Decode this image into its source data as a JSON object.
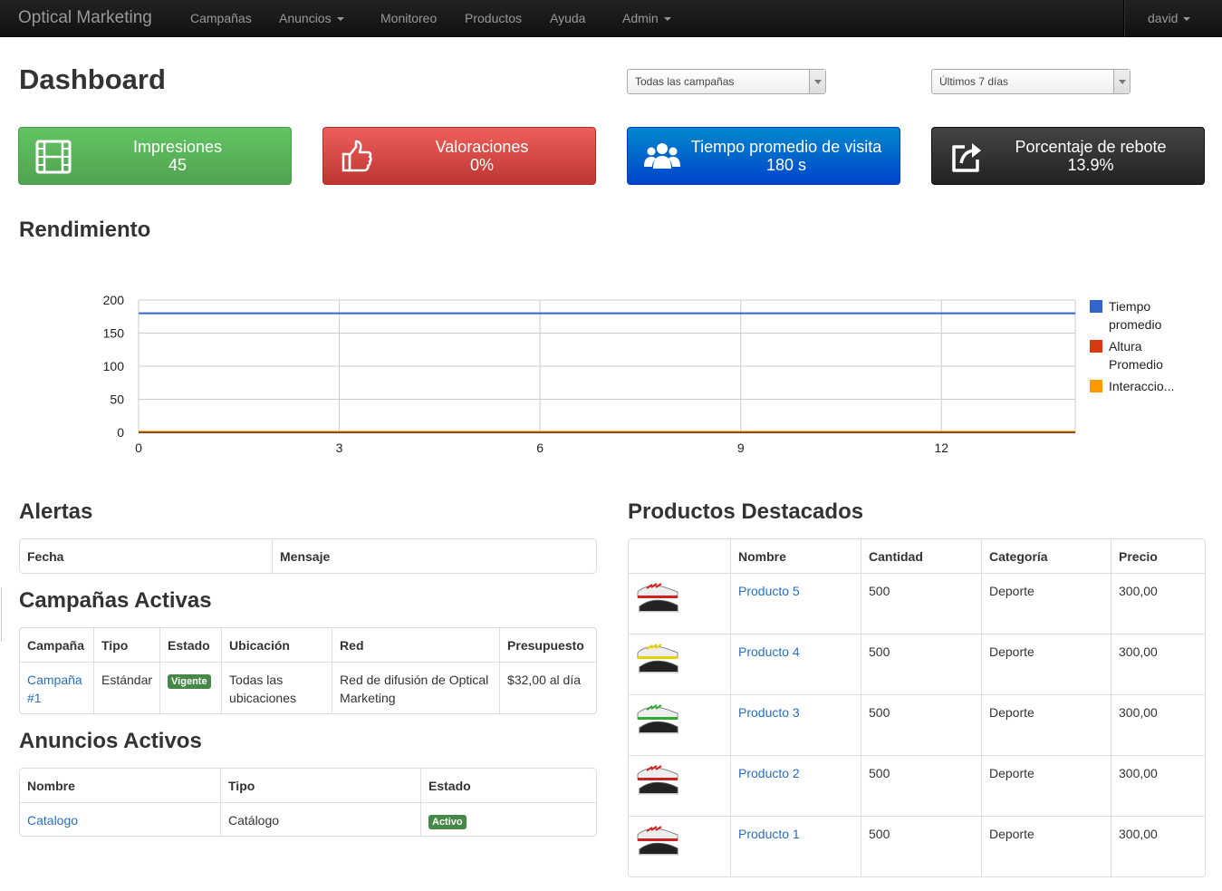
{
  "navbar": {
    "brand": "Optical Marketing",
    "items": [
      "Campañas",
      "Anuncios",
      "Monitoreo",
      "Productos",
      "Ayuda",
      "Admin"
    ],
    "user": "david"
  },
  "page_title": "Dashboard",
  "filters": {
    "campaign_select": "Todas las campañas",
    "period_select": "Últimos 7 días"
  },
  "stats": [
    {
      "label": "Impresiones",
      "value": "45",
      "icon": "film-icon",
      "color": "#5bb75b"
    },
    {
      "label": "Valoraciones",
      "value": "0%",
      "icon": "thumbs-up-icon",
      "color": "#da4f49"
    },
    {
      "label": "Tiempo promedio de visita",
      "value": "180 s",
      "icon": "users-icon",
      "color": "#0066cc"
    },
    {
      "label": "Porcentaje de rebote",
      "value": "13.9%",
      "icon": "external-link-icon",
      "color": "#333333"
    }
  ],
  "sections": {
    "performance": "Rendimiento",
    "alerts": "Alertas",
    "active_campaigns": "Campañas Activas",
    "active_ads": "Anuncios Activos",
    "featured_products": "Productos Destacados"
  },
  "chart_data": {
    "type": "line",
    "x": [
      0,
      1,
      2,
      3,
      4,
      5,
      6,
      7,
      8,
      9,
      10,
      11,
      12,
      13,
      14
    ],
    "xticks": [
      0,
      3,
      6,
      9,
      12
    ],
    "yticks": [
      0,
      50,
      100,
      150,
      200
    ],
    "ylim": [
      0,
      200
    ],
    "xlim": [
      0,
      14
    ],
    "grid": true,
    "legend_position": "right",
    "series": [
      {
        "name": "Tiempo promedio",
        "color": "#3366cc",
        "values": [
          180,
          180,
          180,
          180,
          180,
          180,
          180,
          180,
          180,
          180,
          180,
          180,
          180,
          180,
          180
        ]
      },
      {
        "name": "Altura Promedio",
        "color": "#dc3912",
        "values": [
          0,
          0,
          0,
          0,
          0,
          0,
          0,
          0,
          0,
          0,
          0,
          0,
          0,
          0,
          0
        ]
      },
      {
        "name": "Interaccio...",
        "color": "#ff9900",
        "values": [
          1,
          1,
          1,
          1,
          1,
          1,
          1,
          1,
          1,
          1,
          1,
          1,
          1,
          1,
          1
        ]
      }
    ]
  },
  "alerts_table": {
    "headers": [
      "Fecha",
      "Mensaje"
    ]
  },
  "campaigns_table": {
    "headers": [
      "Campaña",
      "Tipo",
      "Estado",
      "Ubicación",
      "Red",
      "Presupuesto"
    ],
    "rows": [
      {
        "campaign": "Campaña #1",
        "type": "Estándar",
        "status": "Vigente",
        "location": "Todas las ubicaciones",
        "network": "Red de difusión de Optical Marketing",
        "budget": "$32,00 al día"
      }
    ]
  },
  "ads_table": {
    "headers": [
      "Nombre",
      "Tipo",
      "Estado"
    ],
    "rows": [
      {
        "name": "Catalogo",
        "type": "Catálogo",
        "status": "Activo"
      }
    ]
  },
  "products_table": {
    "headers": [
      "",
      "Nombre",
      "Cantidad",
      "Categoría",
      "Precio"
    ],
    "rows": [
      {
        "name": "Producto 5",
        "qty": "500",
        "category": "Deporte",
        "price": "300,00",
        "shoe_color": "#cc2222"
      },
      {
        "name": "Producto 4",
        "qty": "500",
        "category": "Deporte",
        "price": "300,00",
        "shoe_color": "#e6d200"
      },
      {
        "name": "Producto 3",
        "qty": "500",
        "category": "Deporte",
        "price": "300,00",
        "shoe_color": "#33aa33"
      },
      {
        "name": "Producto 2",
        "qty": "500",
        "category": "Deporte",
        "price": "300,00",
        "shoe_color": "#cc2222"
      },
      {
        "name": "Producto 1",
        "qty": "500",
        "category": "Deporte",
        "price": "300,00",
        "shoe_color": "#cc2222"
      }
    ]
  }
}
